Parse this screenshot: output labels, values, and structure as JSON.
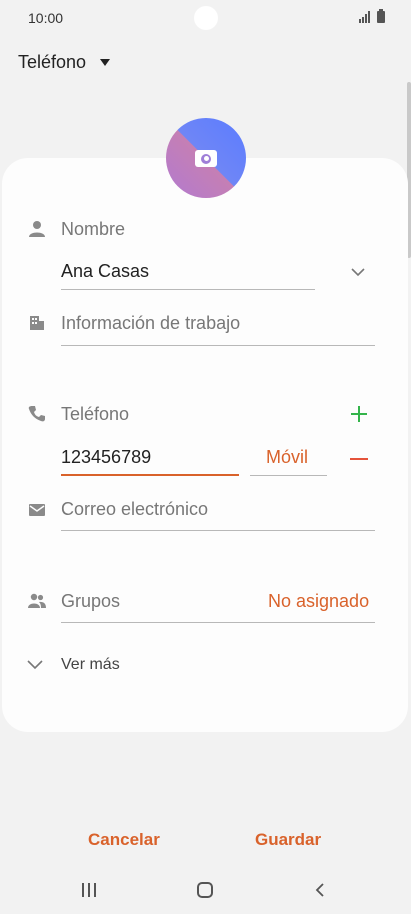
{
  "status_bar": {
    "time": "10:00"
  },
  "header": {
    "account_label": "Teléfono"
  },
  "form": {
    "name_label": "Nombre",
    "name_value": "Ana Casas",
    "work_info_placeholder": "Información de trabajo",
    "phone_label": "Teléfono",
    "phone_value": "123456789",
    "phone_type": "Móvil",
    "email_placeholder": "Correo electrónico",
    "groups_label": "Grupos",
    "groups_value": "No asignado",
    "more_label": "Ver más"
  },
  "actions": {
    "cancel": "Cancelar",
    "save": "Guardar"
  },
  "colors": {
    "accent": "#d9622b",
    "add": "#33b44a",
    "remove": "#e5533b",
    "background": "#f2f2f2"
  },
  "icons": [
    "person-icon",
    "building-icon",
    "phone-icon",
    "email-icon",
    "group-icon",
    "camera-icon",
    "chevron-down-icon",
    "plus-icon",
    "minus-icon"
  ]
}
